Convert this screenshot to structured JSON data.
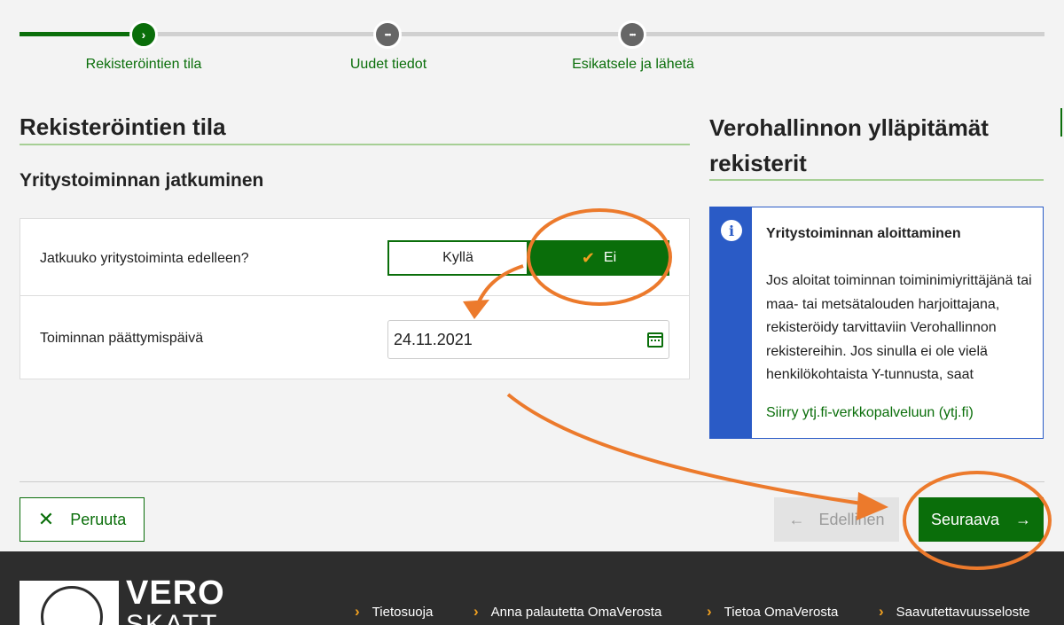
{
  "stepper": {
    "steps": [
      {
        "label": "Rekisteröintien tila",
        "icon": "›"
      },
      {
        "label": "Uudet tiedot",
        "icon": "•••"
      },
      {
        "label": "Esikatsele ja lähetä",
        "icon": "•••"
      }
    ]
  },
  "main": {
    "title": "Rekisteröintien tila",
    "subtitle": "Yritystoiminnan jatkuminen",
    "question": "Jatkuuko yritystoiminta edelleen?",
    "options": {
      "yes": "Kyllä",
      "no": "Ei"
    },
    "selected": "no",
    "end_date_label": "Toiminnan päättymispäivä",
    "end_date_value": "24.11.2021"
  },
  "side": {
    "title": "Verohallinnon ylläpitämät rekisterit",
    "info_title": "Yritystoiminnan aloittaminen",
    "info_text": "Jos aloitat toiminnan toiminimiyrittäjänä tai maa- tai metsätalouden harjoittajana, rekisteröidy tarvittaviin Verohallinnon rekistereihin. Jos sinulla ei ole vielä henkilökohtaista Y-tunnusta, saat",
    "info_link": "Siirry ytj.fi-verkkopalveluun (ytj.fi)"
  },
  "actions": {
    "cancel": "Peruuta",
    "cancel_icon": "✕",
    "prev": "Edellinen",
    "prev_icon": "←",
    "next": "Seuraava",
    "next_icon": "→"
  },
  "footer": {
    "logo_main": "VERO",
    "logo_sub": "SKATT",
    "links": [
      "Tietosuoja",
      "Anna palautetta OmaVerosta",
      "Tietoa OmaVerosta",
      "Saavutettavuusseloste"
    ]
  },
  "colors": {
    "primary_green": "#0a6e0a",
    "info_blue": "#2a5bc6",
    "annotation_orange": "#ec7a2c",
    "footer_bg": "#2d2d2d"
  }
}
